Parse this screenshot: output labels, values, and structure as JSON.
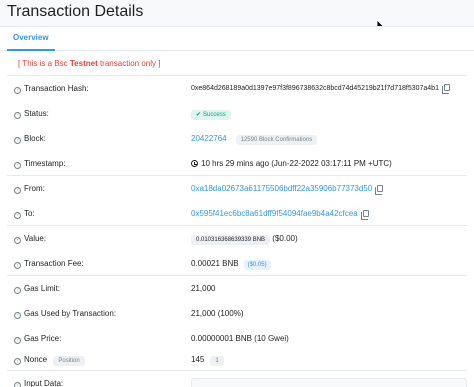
{
  "page": {
    "title": "Transaction Details"
  },
  "tabs": [
    {
      "label": "Overview"
    }
  ],
  "notice": {
    "prefix": "[ This is a Bsc ",
    "emphasis": "Testnet",
    "suffix": " transaction only ]"
  },
  "rows": {
    "tx_hash": {
      "label": "Transaction Hash:",
      "value": "0xe864d268189a0d1397e97f3f896738632c8bcd74d45219b21f7d718f5307a4b1"
    },
    "status": {
      "label": "Status:",
      "value": "Success"
    },
    "block": {
      "label": "Block:",
      "value": "20422764",
      "confirmations": "12590 Block Confirmations"
    },
    "timestamp": {
      "label": "Timestamp:",
      "value": "10 hrs 29 mins ago (Jun-22-2022 03:17:11 PM +UTC)"
    },
    "from": {
      "label": "From:",
      "value": "0xa18da02673a61175506bdff22a35906b77373d50"
    },
    "to": {
      "label": "To:",
      "value": "0x595f41ec6bc8a61dff9f54094fae9b4a42cfcea"
    },
    "value": {
      "label": "Value:",
      "amount": "0.010316368639339 BNB",
      "usd": "($0.00)"
    },
    "fee": {
      "label": "Transaction Fee:",
      "value": "0.00021 BNB",
      "usd": "($0.05)"
    },
    "gas_limit": {
      "label": "Gas Limit:",
      "value": "21,000"
    },
    "gas_used": {
      "label": "Gas Used by Transaction:",
      "value": "21,000 (100%)"
    },
    "gas_price": {
      "label": "Gas Price:",
      "value": "0.00000001 BNB (10 Gwei)"
    },
    "nonce": {
      "label": "Nonce",
      "tag": "Position",
      "value": "145",
      "position": "1"
    },
    "input": {
      "label": "Input Data:"
    }
  },
  "colors": {
    "link": "#3498db",
    "success": "#00a186",
    "notice": "#de4437"
  }
}
